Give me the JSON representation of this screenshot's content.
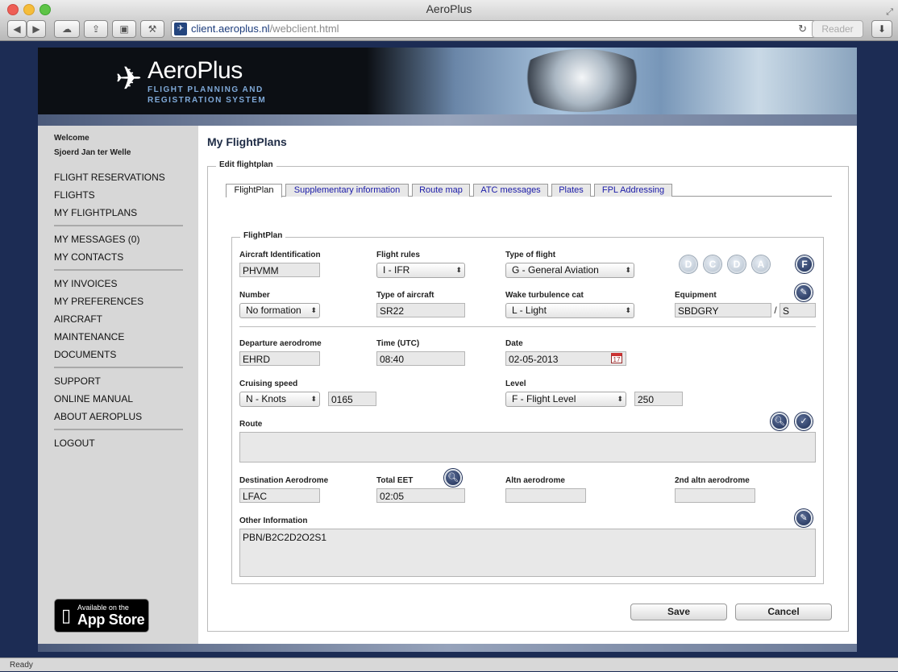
{
  "window": {
    "title": "AeroPlus"
  },
  "browser": {
    "url_host": "client.aeroplus.nl",
    "url_path": "/webclient.html",
    "reader_label": "Reader",
    "status": "Ready"
  },
  "brand": {
    "name": "AeroPlus",
    "tagline": "FLIGHT PLANNING AND REGISTRATION SYSTEM"
  },
  "sidebar": {
    "welcome": "Welcome",
    "user": "Sjoerd Jan ter Welle",
    "groups": [
      [
        "FLIGHT RESERVATIONS",
        "FLIGHTS",
        "MY FLIGHTPLANS"
      ],
      [
        "MY MESSAGES (0)",
        "MY CONTACTS"
      ],
      [
        "MY INVOICES",
        "MY PREFERENCES",
        "AIRCRAFT",
        "MAINTENANCE",
        "DOCUMENTS"
      ],
      [
        "SUPPORT",
        "ONLINE MANUAL",
        "ABOUT AEROPLUS"
      ],
      [
        "LOGOUT"
      ]
    ],
    "appstore_line1": "Available on the",
    "appstore_line2": "App Store"
  },
  "main": {
    "title": "My FlightPlans",
    "edit_legend": "Edit flightplan",
    "tabs": [
      "FlightPlan",
      "Supplementary information",
      "Route map",
      "ATC messages",
      "Plates",
      "FPL Addressing"
    ],
    "status_circles": [
      "D",
      "C",
      "D",
      "A",
      "F"
    ],
    "fp_legend": "FlightPlan"
  },
  "form": {
    "aircraft_id": {
      "label": "Aircraft Identification",
      "value": "PHVMM"
    },
    "flight_rules": {
      "label": "Flight rules",
      "value": "I - IFR"
    },
    "type_of_flight": {
      "label": "Type of flight",
      "value": "G - General Aviation"
    },
    "number": {
      "label": "Number",
      "value": "No formation"
    },
    "type_of_aircraft": {
      "label": "Type of aircraft",
      "value": "SR22"
    },
    "wake": {
      "label": "Wake turbulence cat",
      "value": "L - Light"
    },
    "equipment": {
      "label": "Equipment",
      "value": "SBDGRY",
      "separator": "/",
      "value2": "S"
    },
    "departure": {
      "label": "Departure aerodrome",
      "value": "EHRD"
    },
    "time": {
      "label": "Time (UTC)",
      "value": "08:40"
    },
    "date": {
      "label": "Date",
      "value": "02-05-2013"
    },
    "cruising_speed": {
      "label": "Cruising speed",
      "unit": "N - Knots",
      "value": "0165"
    },
    "level": {
      "label": "Level",
      "unit": "F - Flight Level",
      "value": "250"
    },
    "route": {
      "label": "Route",
      "value": ""
    },
    "destination": {
      "label": "Destination Aerodrome",
      "value": "LFAC"
    },
    "total_eet": {
      "label": "Total EET",
      "value": "02:05"
    },
    "altn": {
      "label": "Altn aerodrome",
      "value": ""
    },
    "altn2": {
      "label": "2nd altn aerodrome",
      "value": ""
    },
    "other": {
      "label": "Other Information",
      "value": "PBN/B2C2D2O2S1"
    }
  },
  "actions": {
    "save": "Save",
    "cancel": "Cancel"
  }
}
